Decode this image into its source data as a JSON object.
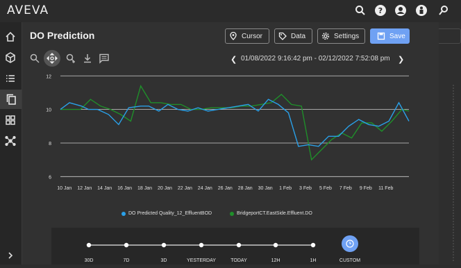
{
  "app": {
    "brand": "AVEVA"
  },
  "page": {
    "title": "DO Prediction"
  },
  "toolbar": {
    "cursor": "Cursor",
    "data": "Data",
    "settings": "Settings",
    "save": "Save"
  },
  "range": {
    "text": "01/08/2022 9:16:42 pm - 02/12/2022 7:52:08 pm"
  },
  "colors": {
    "series1": "#2aa0e8",
    "series2": "#1f8f2a",
    "accent": "#6fa1f3"
  },
  "chart_data": {
    "type": "line",
    "ylim": [
      5.6,
      12.3
    ],
    "yticks": [
      6,
      8,
      10,
      12
    ],
    "xlim": [
      9.6,
      44.3
    ],
    "xticks": [
      {
        "x": 10,
        "label": "10 Jan"
      },
      {
        "x": 12,
        "label": "12 Jan"
      },
      {
        "x": 14,
        "label": "14 Jan"
      },
      {
        "x": 16,
        "label": "16 Jan"
      },
      {
        "x": 18,
        "label": "18 Jan"
      },
      {
        "x": 20,
        "label": "20 Jan"
      },
      {
        "x": 22,
        "label": "22 Jan"
      },
      {
        "x": 24,
        "label": "24 Jan"
      },
      {
        "x": 26,
        "label": "26 Jan"
      },
      {
        "x": 28,
        "label": "28 Jan"
      },
      {
        "x": 30,
        "label": "30 Jan"
      },
      {
        "x": 32,
        "label": "1 Feb"
      },
      {
        "x": 34,
        "label": "3 Feb"
      },
      {
        "x": 36,
        "label": "5 Feb"
      },
      {
        "x": 38,
        "label": "7 Feb"
      },
      {
        "x": 40,
        "label": "9 Feb"
      },
      {
        "x": 42,
        "label": "11 Feb"
      }
    ],
    "series": [
      {
        "name": "DO Predicted Quality_12_EffluentBOD",
        "points": [
          [
            9.6,
            10.0
          ],
          [
            10.5,
            10.4
          ],
          [
            11.7,
            10.2
          ],
          [
            12.4,
            10.0
          ],
          [
            13.3,
            10.0
          ],
          [
            14.4,
            9.7
          ],
          [
            15.4,
            9.1
          ],
          [
            16.4,
            10.1
          ],
          [
            17.6,
            10.2
          ],
          [
            18.4,
            10.2
          ],
          [
            19.4,
            9.9
          ],
          [
            20.3,
            10.3
          ],
          [
            21.3,
            10.0
          ],
          [
            22.3,
            9.9
          ],
          [
            23.3,
            10.1
          ],
          [
            24.3,
            9.9
          ],
          [
            25.3,
            10.0
          ],
          [
            26.3,
            10.1
          ],
          [
            27.3,
            10.2
          ],
          [
            28.3,
            10.3
          ],
          [
            29.3,
            9.9
          ],
          [
            30.3,
            10.6
          ],
          [
            31.3,
            10.3
          ],
          [
            32.3,
            9.8
          ],
          [
            33.3,
            7.8
          ],
          [
            34.3,
            7.9
          ],
          [
            35.3,
            7.8
          ],
          [
            36.3,
            8.4
          ],
          [
            37.3,
            8.4
          ],
          [
            38.3,
            9.0
          ],
          [
            39.3,
            9.4
          ],
          [
            40.3,
            9.1
          ],
          [
            41.3,
            9.0
          ],
          [
            42.3,
            9.3
          ],
          [
            43.3,
            10.4
          ],
          [
            44.3,
            9.3
          ]
        ]
      },
      {
        "name": "BridgeportCT.EastSide.Effluent.DO",
        "points": [
          [
            9.6,
            10.0
          ],
          [
            10.6,
            10.0
          ],
          [
            11.6,
            10.0
          ],
          [
            12.6,
            10.6
          ],
          [
            13.6,
            10.2
          ],
          [
            14.6,
            10.0
          ],
          [
            15.6,
            9.7
          ],
          [
            16.6,
            9.3
          ],
          [
            17.6,
            11.4
          ],
          [
            18.6,
            10.4
          ],
          [
            19.6,
            10.4
          ],
          [
            20.6,
            10.3
          ],
          [
            21.6,
            10.3
          ],
          [
            22.6,
            10.0
          ],
          [
            23.6,
            10.0
          ],
          [
            24.6,
            10.1
          ],
          [
            25.6,
            10.1
          ],
          [
            26.6,
            10.1
          ],
          [
            27.6,
            10.2
          ],
          [
            28.6,
            10.2
          ],
          [
            29.6,
            10.3
          ],
          [
            30.6,
            10.4
          ],
          [
            31.6,
            10.9
          ],
          [
            32.6,
            10.3
          ],
          [
            33.6,
            10.2
          ],
          [
            34.6,
            7.0
          ],
          [
            35.6,
            7.6
          ],
          [
            36.6,
            8.2
          ],
          [
            37.6,
            8.6
          ],
          [
            38.6,
            8.3
          ],
          [
            39.6,
            9.2
          ],
          [
            40.6,
            9.2
          ],
          [
            41.6,
            8.7
          ],
          [
            42.6,
            9.3
          ],
          [
            43.6,
            10.0
          ],
          [
            44.3,
            9.9
          ]
        ]
      }
    ]
  },
  "timeline": {
    "items": [
      "30D",
      "7D",
      "3D",
      "YESTERDAY",
      "TODAY",
      "12H",
      "1H",
      "CUSTOM"
    ],
    "selected": "CUSTOM"
  }
}
